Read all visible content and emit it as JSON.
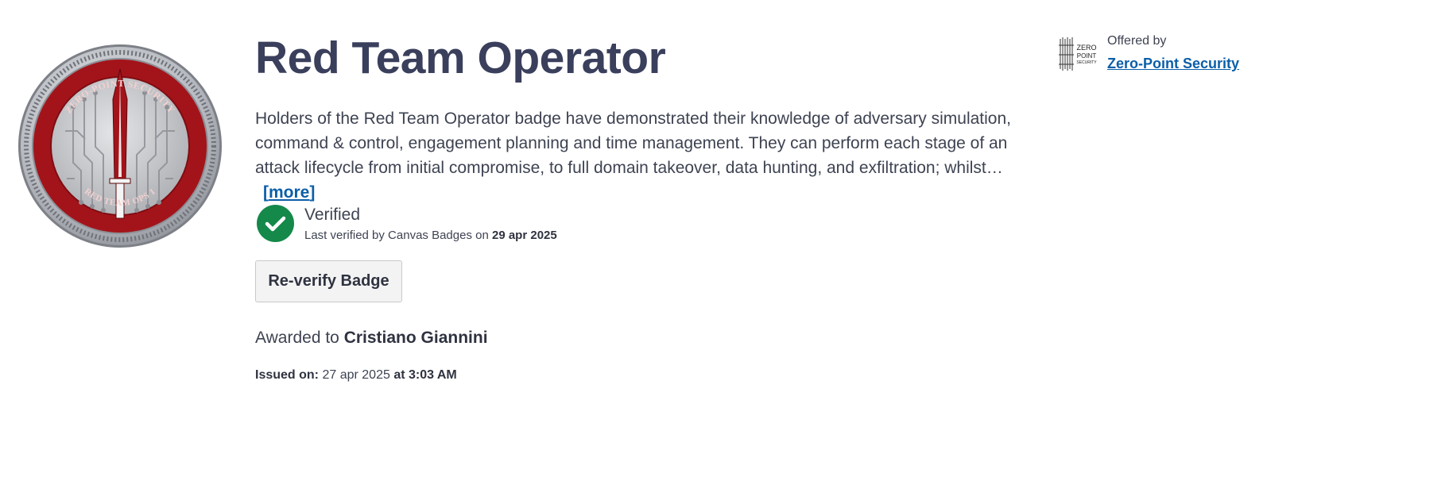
{
  "badge": {
    "title": "Red Team Operator",
    "image_ring_top_text": "ZERO-POINT SECURITY",
    "image_ring_bottom_text": "RED TEAM OPS 1",
    "description": "Holders of the Red Team Operator badge have demonstrated their knowledge of adversary simulation, command & control, engagement planning and time management. They can perform each stage of an attack lifecycle from initial compromise, to full domain takeover, data hunting, and exfiltration; whilst…",
    "more_open": "[",
    "more_label": "more",
    "more_close": "]"
  },
  "verification": {
    "status": "Verified",
    "sub_prefix": "Last verified by Canvas Badges on",
    "date": "29 apr 2025",
    "icon": "check-circle-icon",
    "color": "#14894a"
  },
  "actions": {
    "reverify_label": "Re-verify Badge"
  },
  "award": {
    "prefix": "Awarded to",
    "recipient": "Cristiano Giannini",
    "issued_label": "Issued on:",
    "issued_date": "27 apr 2025",
    "at_time": "at 3:03 AM"
  },
  "issuer": {
    "offered_by": "Offered by",
    "name": "Zero-Point Security",
    "logo_line1": "ZERO",
    "logo_line2": "POINT",
    "logo_line3": "SECURITY"
  },
  "colors": {
    "title": "#3a3f5c",
    "link": "#0b5ea8",
    "badge_red": "#a3141a",
    "badge_silver": "#b9bcc2"
  }
}
